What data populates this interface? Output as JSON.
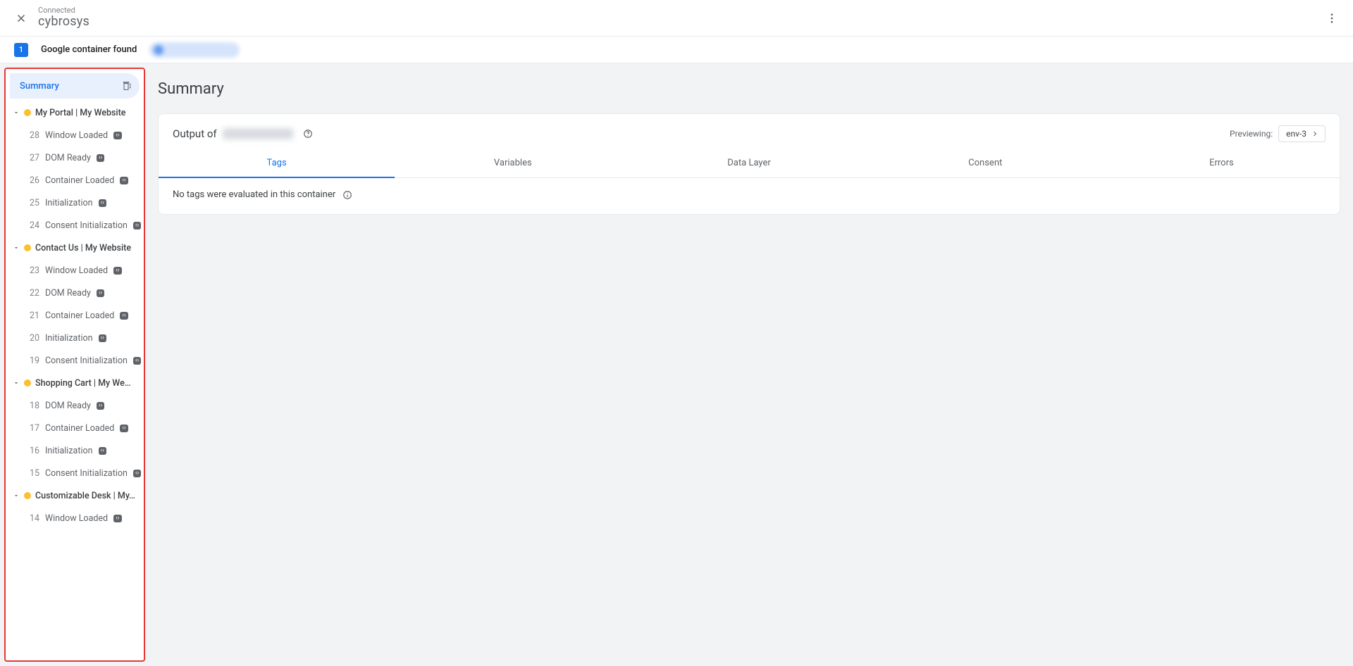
{
  "topbar": {
    "connected_label": "Connected",
    "domain": "cybrosys"
  },
  "subbar": {
    "count": "1",
    "label": "Google container found"
  },
  "sidebar": {
    "summary_label": "Summary",
    "groups": [
      {
        "title": "My Portal | My Website",
        "events": [
          {
            "n": "28",
            "label": "Window Loaded",
            "chip": "‹›"
          },
          {
            "n": "27",
            "label": "DOM Ready",
            "chip": "‹›"
          },
          {
            "n": "26",
            "label": "Container Loaded",
            "chip": "‹›"
          },
          {
            "n": "25",
            "label": "Initialization",
            "chip": "‹›"
          },
          {
            "n": "24",
            "label": "Consent Initialization",
            "chip": "‹›"
          }
        ]
      },
      {
        "title": "Contact Us | My Website",
        "events": [
          {
            "n": "23",
            "label": "Window Loaded",
            "chip": "‹›"
          },
          {
            "n": "22",
            "label": "DOM Ready",
            "chip": "‹›"
          },
          {
            "n": "21",
            "label": "Container Loaded",
            "chip": "‹›"
          },
          {
            "n": "20",
            "label": "Initialization",
            "chip": "‹›"
          },
          {
            "n": "19",
            "label": "Consent Initialization",
            "chip": "‹›"
          }
        ]
      },
      {
        "title": "Shopping Cart | My We…",
        "events": [
          {
            "n": "18",
            "label": "DOM Ready",
            "chip": "‹›"
          },
          {
            "n": "17",
            "label": "Container Loaded",
            "chip": "‹›"
          },
          {
            "n": "16",
            "label": "Initialization",
            "chip": "‹›"
          },
          {
            "n": "15",
            "label": "Consent Initialization",
            "chip": "‹›"
          }
        ]
      },
      {
        "title": "Customizable Desk | My…",
        "events": [
          {
            "n": "14",
            "label": "Window Loaded",
            "chip": "‹›"
          }
        ]
      }
    ]
  },
  "content": {
    "heading": "Summary",
    "output_prefix": "Output of",
    "previewing_label": "Previewing:",
    "env": "env-3",
    "tabs": [
      "Tags",
      "Variables",
      "Data Layer",
      "Consent",
      "Errors"
    ],
    "active_tab": 0,
    "empty_msg": "No tags were evaluated in this container"
  }
}
